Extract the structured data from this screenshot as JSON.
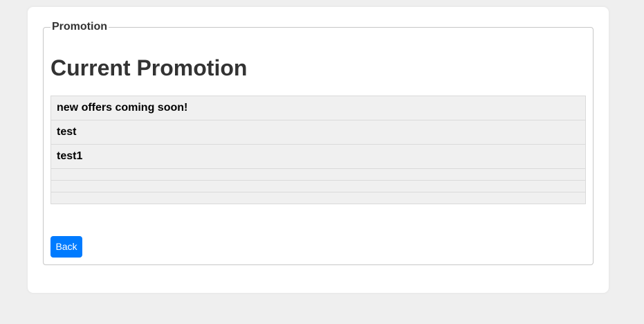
{
  "section": {
    "legend": "Promotion",
    "title": "Current Promotion"
  },
  "promotions": [
    "new offers coming soon!",
    "test",
    "test1",
    "",
    "",
    ""
  ],
  "actions": {
    "back_label": "Back"
  },
  "colors": {
    "background": "#efefef",
    "card": "#ffffff",
    "row_fill": "#f0f0f0",
    "button": "#007bff"
  }
}
